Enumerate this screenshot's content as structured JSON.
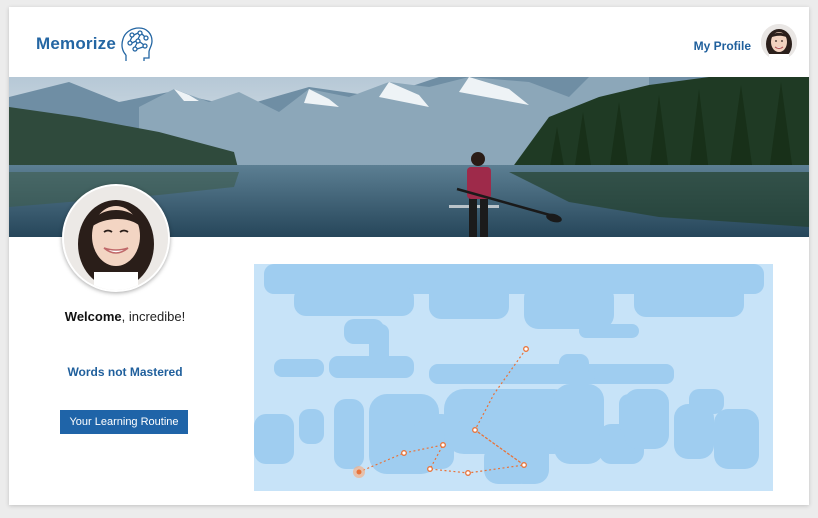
{
  "header": {
    "app_name": "Memorize",
    "profile_link": "My Profile"
  },
  "main": {
    "welcome_greeting": "Welcome",
    "welcome_rest": ", incredibe!",
    "words_link": "Words not Mastered",
    "routine_button": "Your Learning Routine"
  },
  "colors": {
    "brand": "#2466a3",
    "button": "#1f64a8",
    "map_background": "#c7e3f8",
    "map_land": "#9fcdf0",
    "route": "#e8733a"
  },
  "icons": [
    "brain-icon",
    "map-marker-icon"
  ]
}
